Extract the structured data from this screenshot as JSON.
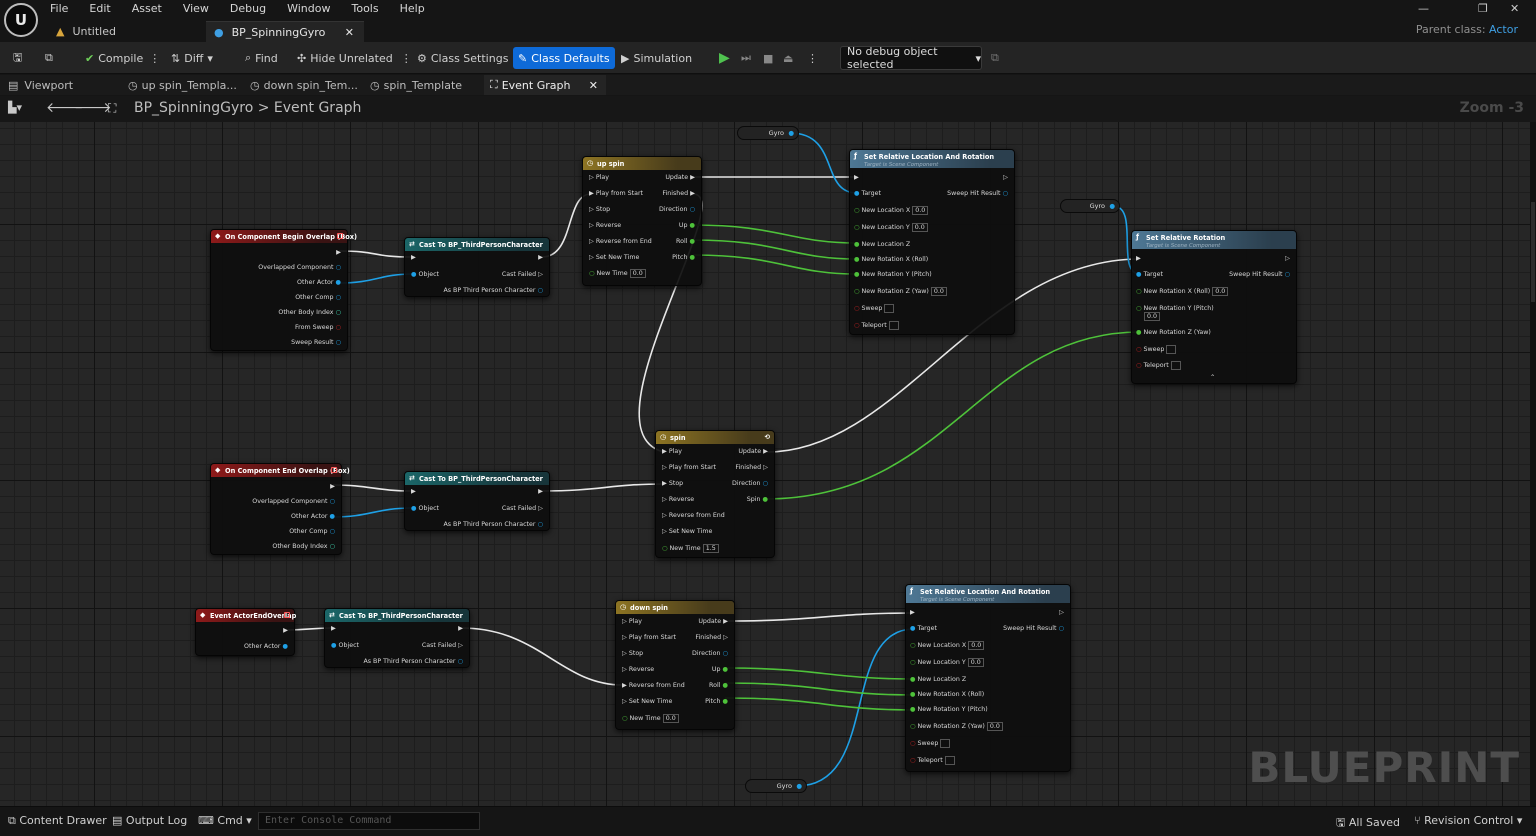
{
  "menu": [
    "File",
    "Edit",
    "Asset",
    "View",
    "Debug",
    "Window",
    "Tools",
    "Help"
  ],
  "document_tabs": [
    {
      "label": "Untitled"
    },
    {
      "label": "BP_SpinningGyro"
    }
  ],
  "parent_class": {
    "label": "Parent class:",
    "value": "Actor"
  },
  "toolbar": {
    "compile": "Compile",
    "diff": "Diff",
    "find": "Find",
    "hide_unrelated": "Hide Unrelated",
    "class_settings": "Class Settings",
    "class_defaults": "Class Defaults",
    "simulation": "Simulation",
    "debug_object": "No debug object selected"
  },
  "editor_tabs": [
    "Viewport",
    "up spin_Templa...",
    "down spin_Tem...",
    "spin_Template",
    "Event Graph"
  ],
  "breadcrumb": {
    "root": "BP_SpinningGyro",
    "separator": ">",
    "current": "Event Graph"
  },
  "zoom": "Zoom -3",
  "watermark": "BLUEPRINT",
  "nodes": {
    "overlap_begin": {
      "title": "On Component Begin Overlap (Box)",
      "pins": [
        "Overlapped Component",
        "Other Actor",
        "Other Comp",
        "Other Body Index",
        "From Sweep",
        "Sweep Result"
      ]
    },
    "overlap_end": {
      "title": "On Component End Overlap (Box)",
      "pins": [
        "Overlapped Component",
        "Other Actor",
        "Other Comp",
        "Other Body Index"
      ]
    },
    "actor_end": {
      "title": "Event ActorEndOverlap",
      "pins": [
        "Other Actor"
      ]
    },
    "cast": {
      "title": "Cast To BP_ThirdPersonCharacter",
      "object": "Object",
      "cast_failed": "Cast Failed",
      "as_bp": "As BP Third Person Character"
    },
    "timeline_up": {
      "title": "up spin",
      "inputs": [
        "Play",
        "Play from Start",
        "Stop",
        "Reverse",
        "Reverse from End",
        "Set New Time",
        "New Time"
      ],
      "outputs": [
        "Update",
        "Finished",
        "Direction",
        "Up",
        "Roll",
        "Pitch"
      ],
      "new_time": "0.0"
    },
    "timeline_spin": {
      "title": "spin",
      "inputs": [
        "Play",
        "Play from Start",
        "Stop",
        "Reverse",
        "Reverse from End",
        "Set New Time",
        "New Time"
      ],
      "outputs": [
        "Update",
        "Finished",
        "Direction",
        "Spin"
      ],
      "new_time": "1.5"
    },
    "timeline_down": {
      "title": "down spin",
      "inputs": [
        "Play",
        "Play from Start",
        "Stop",
        "Reverse",
        "Reverse from End",
        "Set New Time",
        "New Time"
      ],
      "outputs": [
        "Update",
        "Finished",
        "Direction",
        "Up",
        "Roll",
        "Pitch"
      ],
      "new_time": "0.0"
    },
    "set_loc_rot": {
      "title": "Set Relative Location And Rotation",
      "subtitle": "Target is Scene Component",
      "pins": [
        "Target",
        "New Location X",
        "New Location Y",
        "New Location Z",
        "New Rotation X (Roll)",
        "New Rotation Y (Pitch)",
        "New Rotation Z (Yaw)",
        "Sweep",
        "Teleport"
      ],
      "sweep_hit": "Sweep Hit Result",
      "default_value": "0.0"
    },
    "set_rot": {
      "title": "Set Relative Rotation",
      "subtitle": "Target is Scene Component",
      "pins": [
        "Target",
        "New Rotation X (Roll)",
        "New Rotation Y (Pitch)",
        "New Rotation Z (Yaw)",
        "Sweep",
        "Teleport"
      ],
      "sweep_hit": "Sweep Hit Result",
      "default_value": "0.0"
    },
    "gyro": "Gyro"
  },
  "statusbar": {
    "content_drawer": "Content Drawer",
    "output_log": "Output Log",
    "cmd": "Cmd",
    "console_placeholder": "Enter Console Command",
    "all_saved": "All Saved",
    "revision_control": "Revision Control"
  },
  "colors": {
    "exec": "#ffffff",
    "object": "#00a8f4",
    "float": "#3fe23f",
    "bool": "#b50000",
    "accent": "#0e6ad8"
  }
}
